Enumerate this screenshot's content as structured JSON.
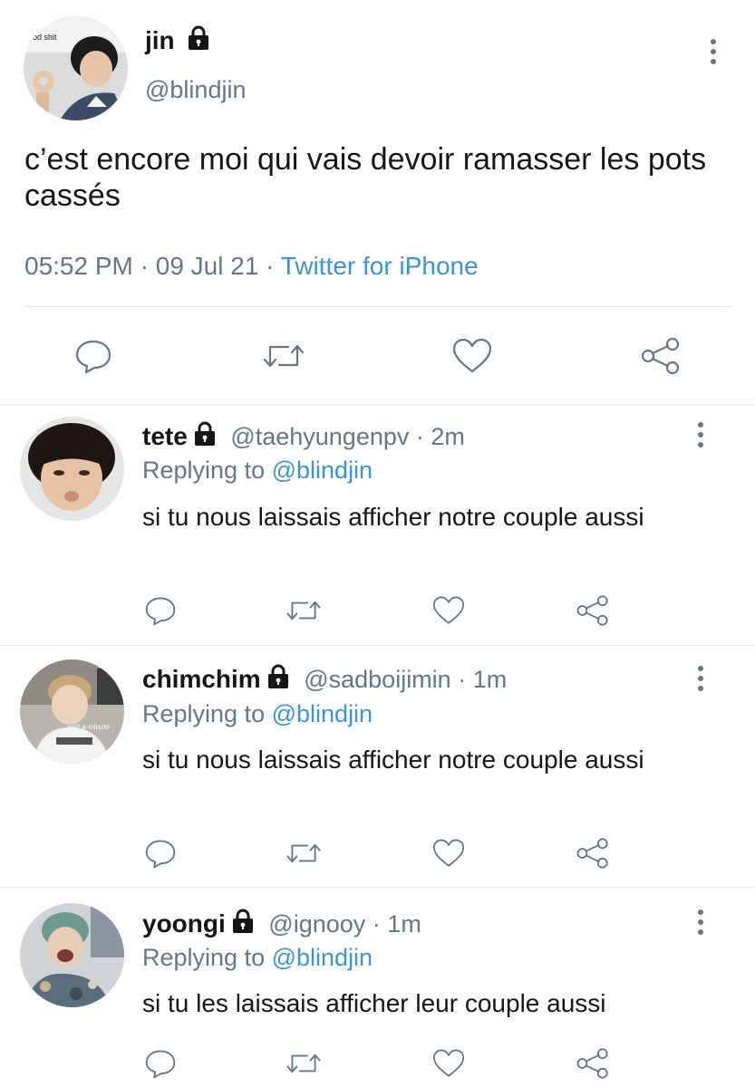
{
  "main_tweet": {
    "display_name": "jin",
    "handle": "@blindjin",
    "avatar_caption": "od shit",
    "text": "c’est encore moi qui vais devoir ramasser les pots cassés",
    "time": "05:52 PM",
    "date": "09 Jul 21",
    "source": "Twitter for iPhone",
    "separator": "·"
  },
  "replies": [
    {
      "display_name": "tete",
      "handle": "@taehyungenpv",
      "time_ago": "2m",
      "replying_prefix": "Replying to",
      "replying_to": "@blindjin",
      "text": "si tu nous laissais afficher notre couple aussi",
      "avatar_caption": ""
    },
    {
      "display_name": "chimchim",
      "handle": "@sadboijimin",
      "time_ago": "1m",
      "replying_prefix": "Replying to",
      "replying_to": "@blindjin",
      "text": "si tu nous laissais afficher notre couple aussi",
      "avatar_caption": "wait a minute"
    },
    {
      "display_name": "yoongi",
      "handle": "@ignooy",
      "time_ago": "1m",
      "replying_prefix": "Replying to",
      "replying_to": "@blindjin",
      "text": "si tu les laissais afficher leur couple aussi",
      "avatar_caption": ""
    }
  ],
  "icons": [
    "reply-icon",
    "retweet-icon",
    "like-icon",
    "share-icon",
    "lock-icon",
    "more-icon"
  ],
  "colors": {
    "link": "#3a94d6",
    "secondary_text": "#657786",
    "divider": "#e1e8ed",
    "text": "#14171a"
  }
}
